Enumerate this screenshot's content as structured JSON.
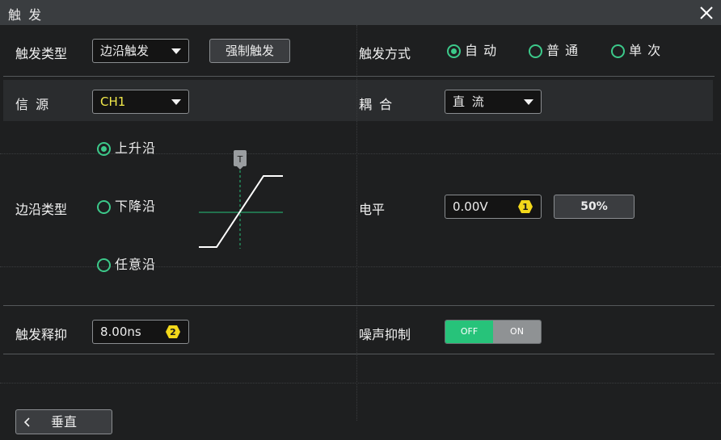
{
  "title": "触 发",
  "header_row": {
    "trigger_type_label": "触发类型",
    "trigger_type_value": "边沿触发",
    "force_trigger_label": "强制触发",
    "sweep_label": "触发方式",
    "sweep_options": [
      "自 动",
      "普 通",
      "单 次"
    ],
    "sweep_selected": 0
  },
  "source_row": {
    "source_label": "信 源",
    "source_value": "CH1",
    "coupling_label": "耦 合",
    "coupling_value": "直 流"
  },
  "edge": {
    "label": "边沿类型",
    "options": [
      "上升沿",
      "下降沿",
      "任意沿"
    ],
    "selected": 0,
    "diagram_marker": "T"
  },
  "level": {
    "label": "电平",
    "value": "0.00V",
    "badge": "1",
    "button_label": "50%"
  },
  "holdoff": {
    "label": "触发释抑",
    "value": "8.00ns",
    "badge": "2"
  },
  "noise_reject": {
    "label": "噪声抑制",
    "off_label": "OFF",
    "on_label": "ON",
    "state": "OFF"
  },
  "footer": {
    "back_label": "垂直"
  },
  "colors": {
    "accent_green": "#27c37a",
    "channel_yellow": "#f2e94a",
    "badge_yellow": "#f2d81a"
  }
}
